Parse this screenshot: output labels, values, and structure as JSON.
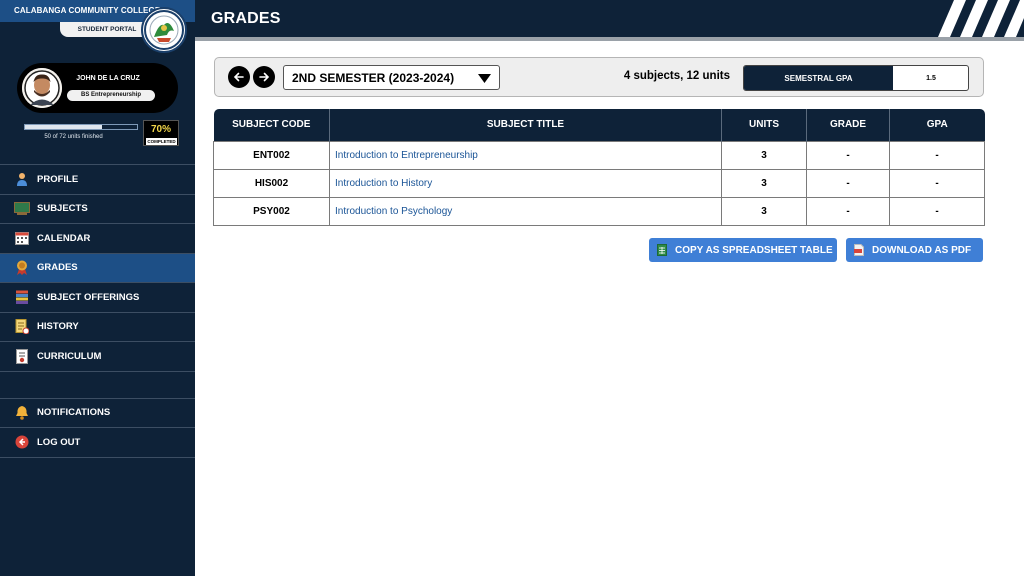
{
  "sidebar": {
    "college_name": "CALABANGA COMMUNITY COLLEGE",
    "portal_label": "STUDENT PORTAL",
    "user": {
      "name": "JOHN DE LA CRUZ",
      "program": "BS Entrepreneurship"
    },
    "progress": {
      "fraction": 0.69,
      "caption": "50 of 72 units finished",
      "percent_text": "70%",
      "percent_label": "COMPLETED"
    },
    "nav_items": [
      {
        "label": "PROFILE",
        "icon": "profile-icon",
        "active": false
      },
      {
        "label": "SUBJECTS",
        "icon": "subjects-icon",
        "active": false
      },
      {
        "label": "CALENDAR",
        "icon": "calendar-icon",
        "active": false
      },
      {
        "label": "GRADES",
        "icon": "grades-icon",
        "active": true
      },
      {
        "label": "SUBJECT OFFERINGS",
        "icon": "offerings-icon",
        "active": false
      },
      {
        "label": "HISTORY",
        "icon": "history-icon",
        "active": false
      },
      {
        "label": "CURRICULUM",
        "icon": "curriculum-icon",
        "active": false
      }
    ],
    "bottom_items": [
      {
        "label": "NOTIFICATIONS",
        "icon": "bell-icon"
      },
      {
        "label": "LOG OUT",
        "icon": "logout-icon"
      }
    ]
  },
  "header": {
    "title": "GRADES"
  },
  "toolbar": {
    "semester": "2ND SEMESTER (2023-2024)",
    "summary": "4 subjects, 12 units",
    "gpa_label": "SEMESTRAL GPA",
    "gpa_value": "1.5"
  },
  "table": {
    "headers": [
      "SUBJECT CODE",
      "SUBJECT TITLE",
      "UNITS",
      "GRADE",
      "GPA"
    ],
    "rows": [
      {
        "code": "ENT002",
        "title": "Introduction to Entrepreneurship",
        "units": "3",
        "grade": "-",
        "gpa": "-"
      },
      {
        "code": "HIS002",
        "title": "Introduction to History",
        "units": "3",
        "grade": "-",
        "gpa": "-"
      },
      {
        "code": "PSY002",
        "title": "Introduction to Psychology",
        "units": "3",
        "grade": "-",
        "gpa": "-"
      }
    ]
  },
  "actions": {
    "copy_label": "COPY AS SPREADSHEET TABLE",
    "pdf_label": "DOWNLOAD AS PDF"
  },
  "colors": {
    "navy": "#0e2238",
    "active_blue": "#1d4f86",
    "button_blue": "#3f7fd6",
    "link_blue": "#1a5496",
    "percent_yellow": "#f4d84a"
  }
}
